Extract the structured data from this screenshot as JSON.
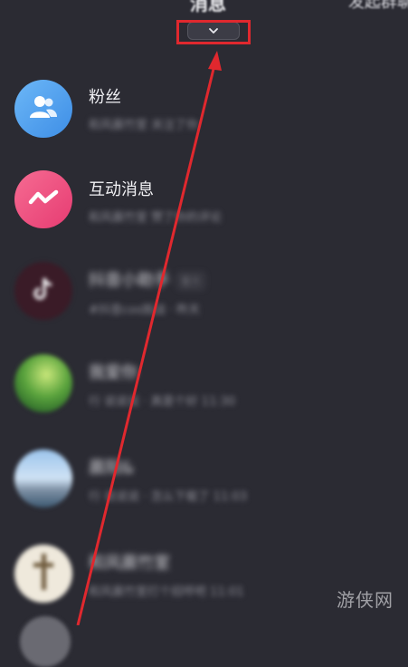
{
  "header": {
    "title": "消息",
    "right_text": "发起群聊"
  },
  "collapse_button": {
    "icon": "chevron-down-icon"
  },
  "messages": [
    {
      "name": "粉丝",
      "preview": "和风晨竹室 关注了你",
      "tag": "",
      "time": "",
      "avatar_icon": "users-icon",
      "avatar_color": "#5aa7f2"
    },
    {
      "name": "互动消息",
      "preview": "和风晨竹室 赞了你的评论",
      "tag": "",
      "time": "",
      "avatar_icon": "zigzag-icon",
      "avatar_color": "#ef4f7f"
    },
    {
      "name": "抖音小助手",
      "preview": "#抖音cos挑战 · 昨天",
      "tag": "官方",
      "time": "",
      "avatar_icon": "tiktok-icon",
      "avatar_color": "#3a1b27"
    },
    {
      "name": "我爱你",
      "preview": "行 说说说 · 真是个好",
      "tag": "",
      "time": "11:30",
      "avatar_icon": "photo-green",
      "avatar_color": "#4b9a3c"
    },
    {
      "name": "晨阳&",
      "preview": "行 说说说 · 怎么下载了",
      "tag": "",
      "time": "11:03",
      "avatar_icon": "photo-sky",
      "avatar_color": "#88b2de"
    },
    {
      "name": "和风晨竹室",
      "preview": "和风晨竹室打个招呼吧",
      "tag": "",
      "time": "11:01",
      "avatar_icon": "photo-cross",
      "avatar_color": "#ece6d8"
    }
  ],
  "watermark": "游侠网",
  "colors": {
    "annotation_red": "#e0282e",
    "background": "#2b2b33"
  }
}
